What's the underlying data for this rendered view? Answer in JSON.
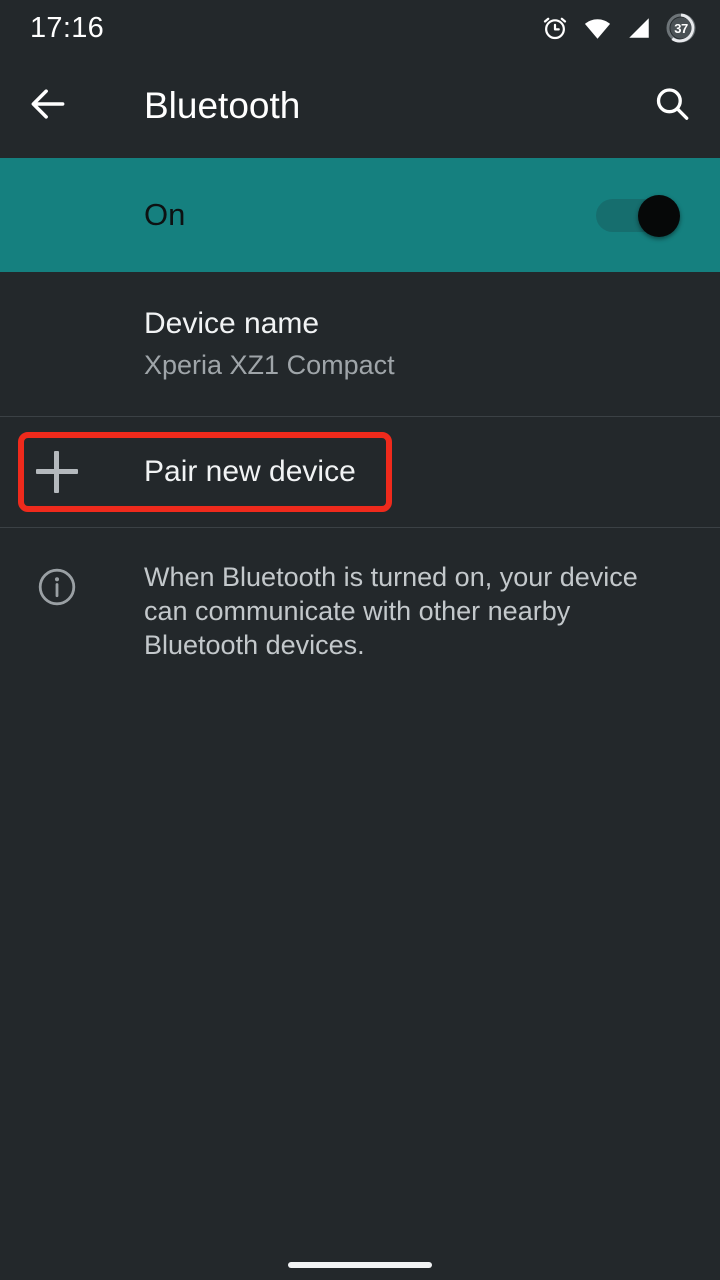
{
  "status_bar": {
    "time": "17:16",
    "icons": [
      {
        "name": "alarm-icon"
      },
      {
        "name": "wifi-icon"
      },
      {
        "name": "cell-signal-icon"
      },
      {
        "name": "battery-icon"
      }
    ],
    "battery_level": "37"
  },
  "app_bar": {
    "back_label": "back-arrow-icon",
    "title": "Bluetooth",
    "search_label": "search-icon"
  },
  "master_switch": {
    "label": "On",
    "state": "on",
    "accent_color": "#15807f"
  },
  "rows": {
    "device_name": {
      "title": "Device name",
      "subtitle": "Xperia XZ1 Compact"
    },
    "pair_new_device": {
      "label": "Pair new device",
      "icon": "plus-icon"
    }
  },
  "info": {
    "icon": "info-icon",
    "text": "When Bluetooth is turned on, your device can communicate with other nearby Bluetooth devices."
  },
  "annotation": {
    "target": "pair_new_device",
    "color": "#ef2a1c"
  },
  "nav_bar": {
    "home_indicator": "home-indicator"
  }
}
